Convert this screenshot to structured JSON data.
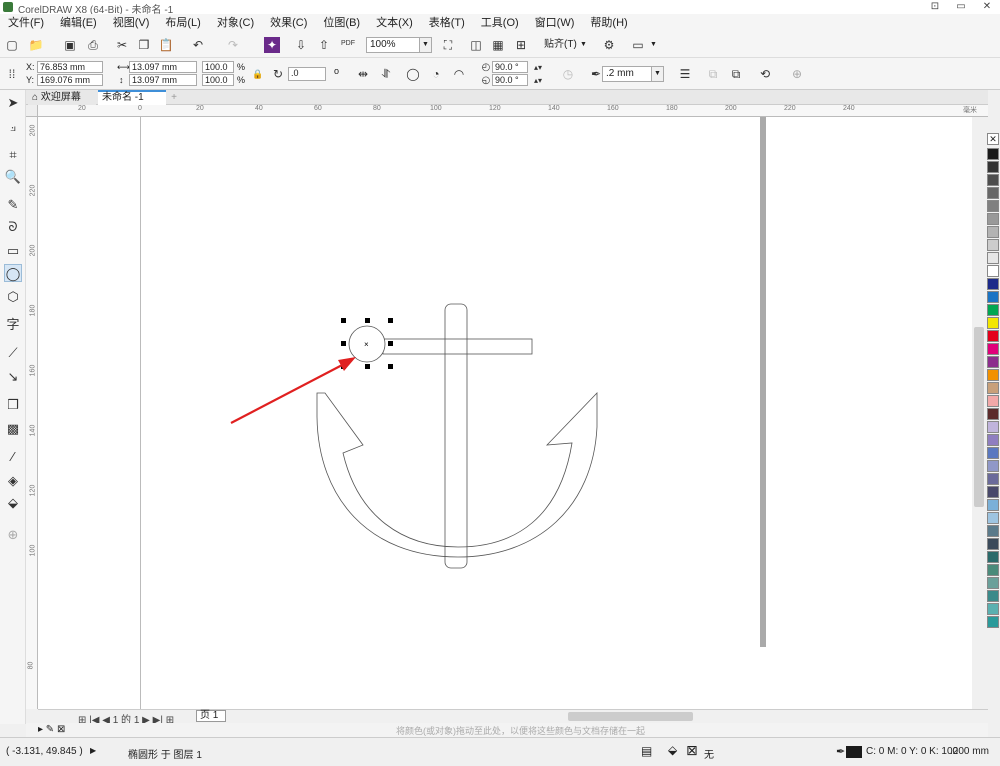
{
  "window": {
    "title": "CorelDRAW X8 (64-Bit) - 未命名 -1",
    "buttons": [
      "⊡",
      "▭",
      "✕"
    ]
  },
  "menu": [
    "文件(F)",
    "编辑(E)",
    "视图(V)",
    "布局(L)",
    "对象(C)",
    "效果(C)",
    "位图(B)",
    "文本(X)",
    "表格(T)",
    "工具(O)",
    "窗口(W)",
    "帮助(H)"
  ],
  "toolbar": {
    "zoom": "100%",
    "snap_label": "贴齐(T)",
    "pdf": "PDF"
  },
  "property_bar": {
    "x_label": "X:",
    "x_value": "76.853 mm",
    "y_label": "Y:",
    "y_value": "169.076 mm",
    "width": "13.097 mm",
    "height": "13.097 mm",
    "scale_w": "100.0",
    "scale_h": "100.0",
    "pct": "%",
    "rotation": ".0",
    "deg": "o",
    "start_angle": "90.0 °",
    "end_angle": "90.0 °",
    "outline_width": ".2 mm"
  },
  "doc_tabs": {
    "welcome": "欢迎屏幕",
    "document": "未命名 -1",
    "plus": "+"
  },
  "ruler": {
    "h_ticks": [
      "20",
      "0",
      "20",
      "40",
      "60",
      "80",
      "100",
      "120",
      "140",
      "160",
      "180",
      "200",
      "220",
      "240"
    ],
    "h_unit": "毫米",
    "v_ticks": [
      "200",
      "220",
      "200",
      "180",
      "160",
      "140",
      "120",
      "100",
      "80"
    ]
  },
  "page_nav": {
    "text": "1 的 1",
    "page_tab": "页 1"
  },
  "hint": "将颜色(或对象)拖动至此处，以便将这些颜色与文档存储在一起",
  "status": {
    "coords": "( -3.131, 49.845 )",
    "object_info": "椭圆形 于 图层 1",
    "fill": "无",
    "outline_color": "C: 0 M: 0 Y: 0 K: 100",
    "outline_width": ".200 mm"
  },
  "colors": {
    "accent_tab": "#3f8fd8",
    "arrow_red": "#e02020",
    "palette": [
      "#1a1a1a",
      "#333333",
      "#4d4d4d",
      "#666666",
      "#808080",
      "#999999",
      "#b3b3b3",
      "#cccccc",
      "#e6e6e6",
      "#ffffff",
      "#1c2a8a",
      "#1a74c4",
      "#00a651",
      "#f2e600",
      "#e3001b",
      "#e0007a",
      "#8c2d8c",
      "#f29100",
      "#c8a07a",
      "#f2a8a8",
      "#5b2a2a",
      "#c0b4dc",
      "#8f7ec0",
      "#5a78c0",
      "#9098c8",
      "#6a6a9a",
      "#48486a",
      "#7ab0d8",
      "#9ec4e0",
      "#5a7a8a",
      "#3a4a5a",
      "#2a6a6a",
      "#4a8a7a",
      "#6aa09a",
      "#3a8a8a",
      "#5ab0b0",
      "#2a9a9a"
    ]
  }
}
